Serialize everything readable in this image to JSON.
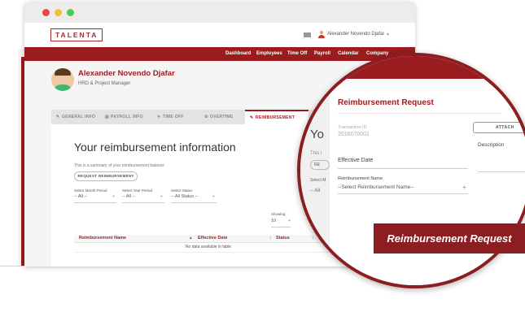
{
  "app": {
    "logo": "TALENTA"
  },
  "header": {
    "user_name": "Alexander Novendo Djafar",
    "caret": "▾"
  },
  "nav": {
    "items": [
      "Dashboard",
      "Employees",
      "Time Off",
      "Payroll",
      "Calendar",
      "Company"
    ]
  },
  "profile": {
    "name": "Alexander Novendo Djafar",
    "role": "HRD & Project Manager"
  },
  "tabs": [
    {
      "icon": "✎",
      "label": "GENERAL INFO"
    },
    {
      "icon": "▤",
      "label": "PAYROLL INFO"
    },
    {
      "icon": "✈",
      "label": "TIME OFF"
    },
    {
      "icon": "⚙",
      "label": "OVERTIME"
    },
    {
      "icon": "✎",
      "label": "REIMBURSEMENT"
    }
  ],
  "content": {
    "title": "Your reimbursement information",
    "subtitle": "This is a summary of your reimbursement balance",
    "request_button": "REQUEST REIMBURSEMENT",
    "filters": [
      {
        "label": "Select Month Period",
        "value": "-- All --"
      },
      {
        "label": "Select Year Period",
        "value": "-- All --"
      },
      {
        "label": "Select Status",
        "value": "-- All Status --"
      }
    ],
    "showing_label": "Showing",
    "showing_value": "10",
    "table": {
      "headers": [
        "Reimbursement Name",
        "Effective Date",
        "Status"
      ],
      "empty": "No data available in table"
    }
  },
  "lens": {
    "ghost_title": "Yo",
    "ghost_sub": "This i",
    "ghost_btn": "RE",
    "ghost_label": "Select M",
    "ghost_select": "-- All",
    "title": "Reimbursement Request",
    "transaction_label": "Transaction ID",
    "transaction_value": "2016070001",
    "attach_button": "ATTACH",
    "description_label": "Description",
    "effective_date_label": "Effective Date",
    "reimbursement_name_label": "Reimbursement Name",
    "reimbursement_name_value": "--Select Reimbursement Name--"
  },
  "banner": {
    "text": "Reimbursement Request"
  },
  "colors": {
    "brand": "#9b1c1f"
  }
}
